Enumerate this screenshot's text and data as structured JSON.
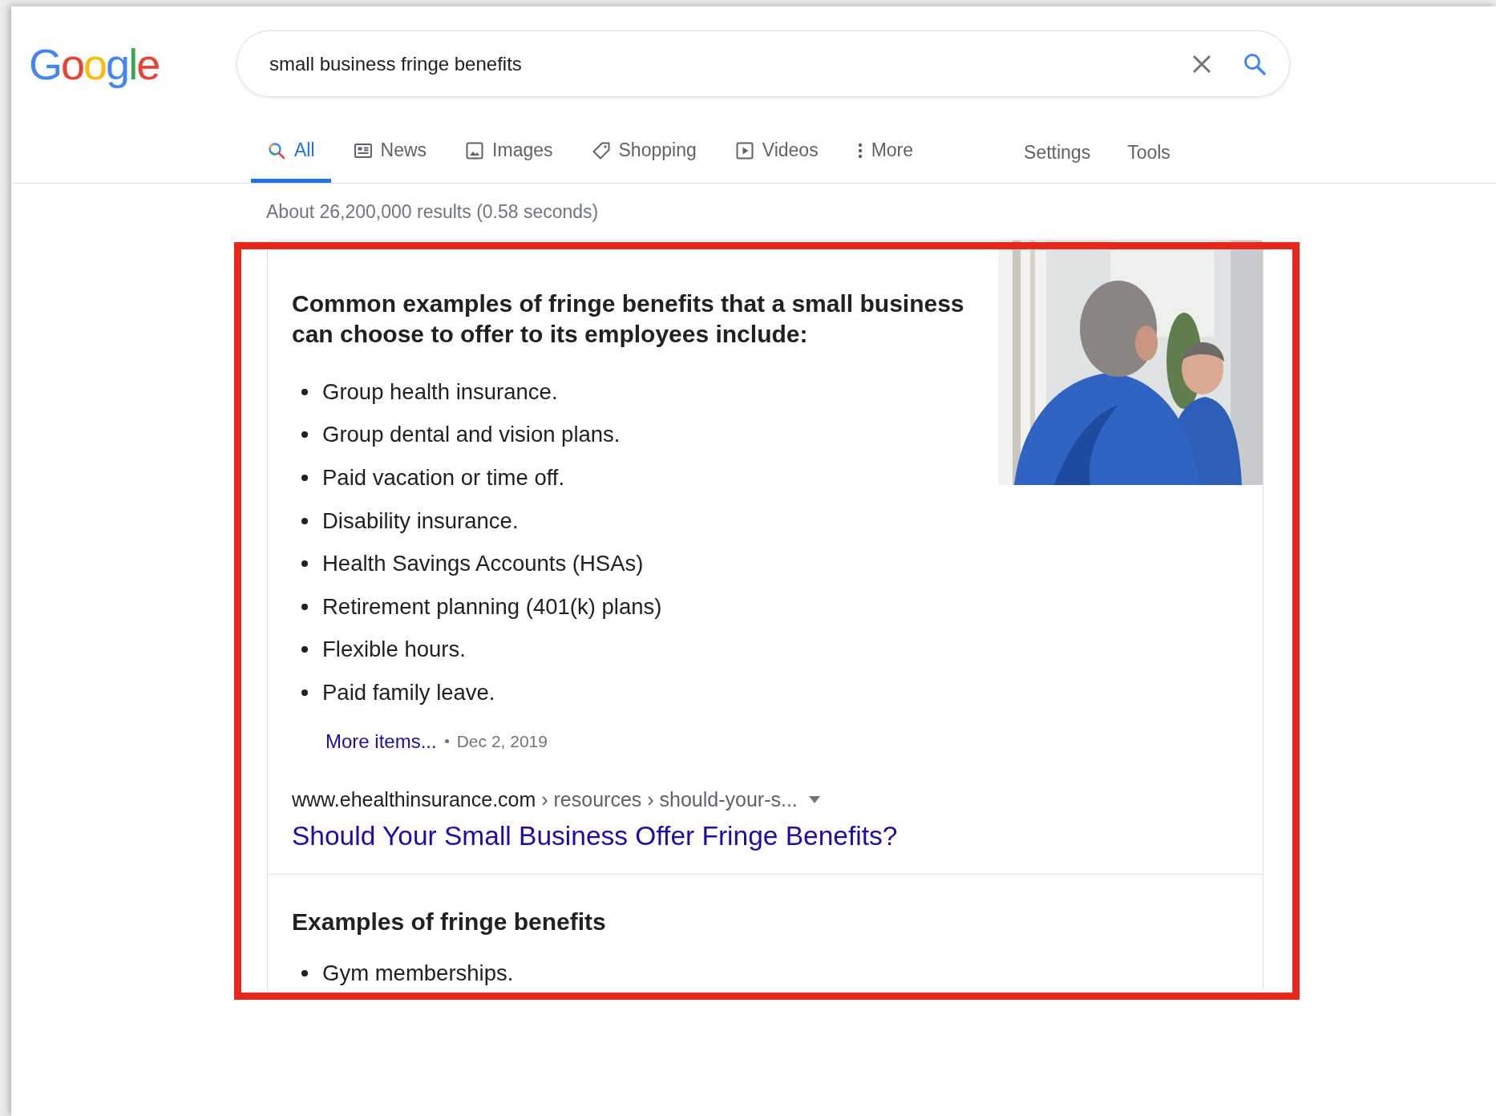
{
  "logo": "Google",
  "search": {
    "value": "small business fringe benefits"
  },
  "tabs": [
    {
      "label": "All",
      "kind": "search",
      "selected": true
    },
    {
      "label": "News",
      "kind": "news",
      "selected": false
    },
    {
      "label": "Images",
      "kind": "images",
      "selected": false
    },
    {
      "label": "Shopping",
      "kind": "shopping",
      "selected": false
    },
    {
      "label": "Videos",
      "kind": "videos",
      "selected": false
    },
    {
      "label": "More",
      "kind": "more",
      "selected": false
    }
  ],
  "tools": [
    "Settings",
    "Tools"
  ],
  "result_stats": "About 26,200,000 results (0.58 seconds)",
  "featured_snippet": {
    "heading": "Common examples of fringe benefits that a small business can choose to offer to its employees include:",
    "items": [
      "Group health insurance.",
      "Group dental and vision plans.",
      "Paid vacation or time off.",
      "Disability insurance.",
      "Health Savings Accounts (HSAs)",
      "Retirement planning (401(k) plans)",
      "Flexible hours.",
      "Paid family leave."
    ],
    "more_link": "More items...",
    "date": "Dec 2, 2019",
    "site": "www.ehealthinsurance.com",
    "path": " › resources › should-your-s...",
    "title": "Should Your Small Business Offer Fringe Benefits?",
    "highlighted": true
  },
  "next_section": {
    "heading": "Examples of fringe benefits",
    "items": [
      "Gym memberships."
    ]
  }
}
